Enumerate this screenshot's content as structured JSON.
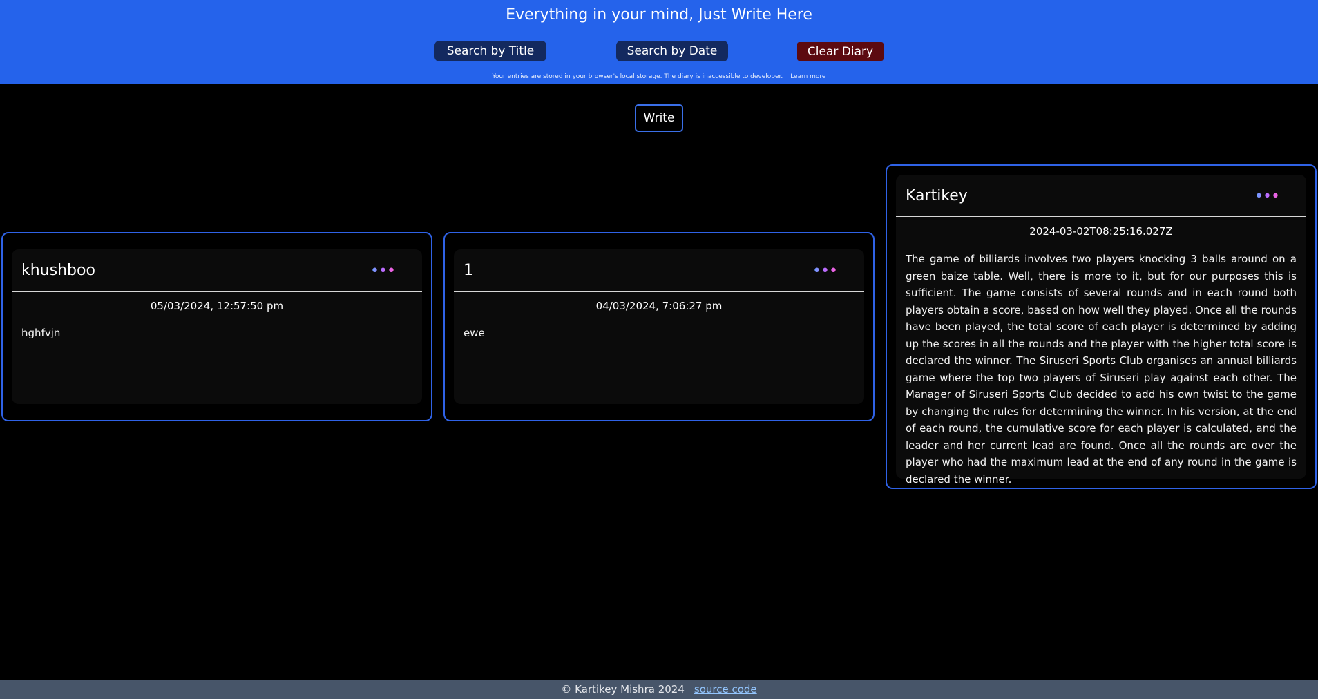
{
  "header": {
    "title": "Everything in your mind, Just Write Here",
    "search_title_label": "Search by Title",
    "search_date_label": "Search by Date",
    "clear_label": "Clear Diary",
    "notice_text": "Your entries are stored in your browser's local storage. The diary is inaccessible to developer.",
    "learn_more_label": "Learn more",
    "background_color": "#2563eb"
  },
  "write_label": "Write",
  "entries": [
    {
      "title": "khushboo",
      "menu_icon": "more-dots-icon",
      "date": "05/03/2024, 12:57:50 pm",
      "body": "hghfvjn"
    },
    {
      "title": "1",
      "menu_icon": "more-dots-icon",
      "date": "04/03/2024, 7:06:27 pm",
      "body": "ewe"
    },
    {
      "title": "Kartikey",
      "menu_icon": "more-dots-icon",
      "date": "2024-03-02T08:25:16.027Z",
      "body": "The game of billiards involves two players knocking 3 balls around on a green baize table. Well, there is more to it, but for our purposes this is sufficient. The game consists of several rounds and in each round both players obtain a score, based on how well they played. Once all the rounds have been played, the total score of each player is determined by adding up the scores in all the rounds and the player with the higher total score is declared the winner. The Siruseri Sports Club organises an annual billiards game where the top two players of Siruseri play against each other. The Manager of Siruseri Sports Club decided to add his own twist to the game by changing the rules for determining the winner. In his version, at the end of each round, the cumulative score for each player is calculated, and the leader and her current lead are found. Once all the rounds are over the player who had the maximum lead at the end of any round in the game is declared the winner."
    }
  ],
  "footer": {
    "copyright": "© Kartikey Mishra 2024",
    "source_label": "source code",
    "background_color": "#475569"
  }
}
